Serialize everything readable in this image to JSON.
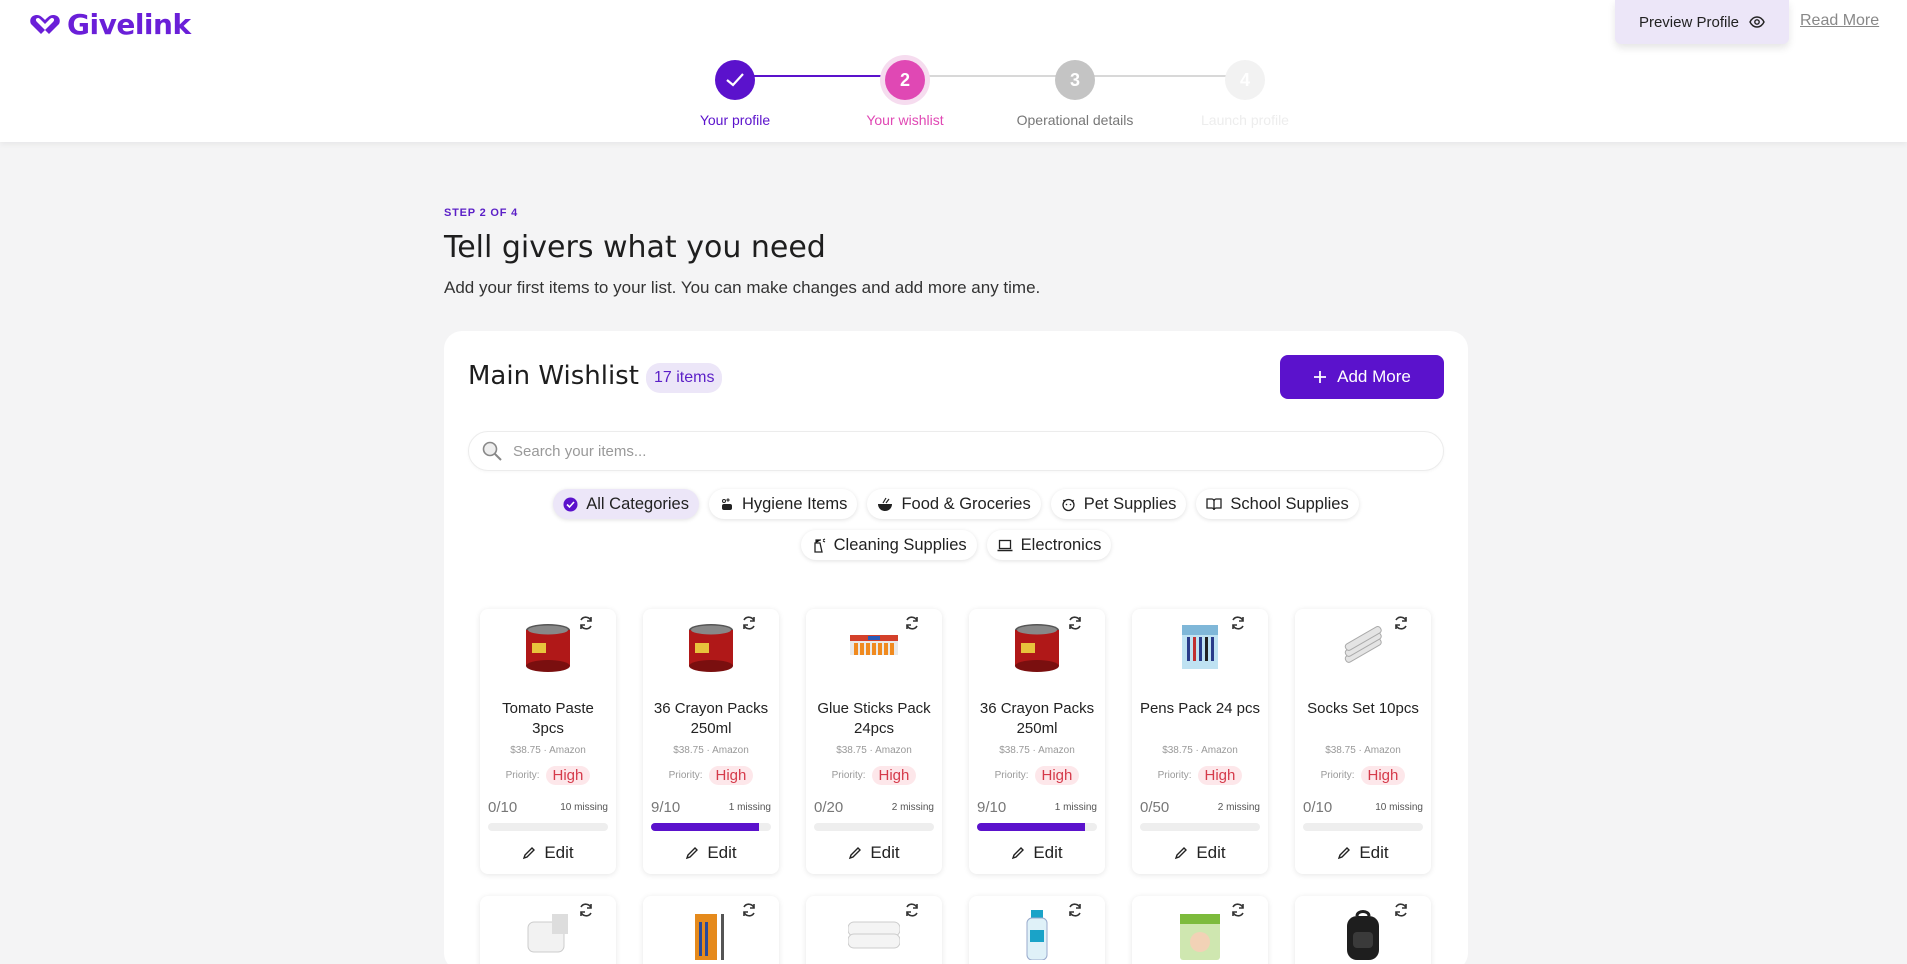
{
  "brand": {
    "name": "Givelink",
    "color": "#6a1fd8"
  },
  "header": {
    "preview_label": "Preview Profile",
    "read_more": "Read More"
  },
  "stepper": {
    "steps": [
      {
        "number": "1",
        "label": "Your profile",
        "state": "complete"
      },
      {
        "number": "2",
        "label": "Your wishlist",
        "state": "current"
      },
      {
        "number": "3",
        "label": "Operational details",
        "state": "upcoming"
      },
      {
        "number": "4",
        "label": "Launch profile",
        "state": "disabled"
      }
    ]
  },
  "content": {
    "kicker": "STEP 2 OF 4",
    "title": "Tell givers what you need",
    "subtitle": "Add your first items to your list. You can  make changes and add more any time."
  },
  "wishlist": {
    "title": "Main Wishlist",
    "count": "17 items",
    "add_label": "Add More",
    "search_placeholder": "Search your items..."
  },
  "categories": {
    "row1": [
      {
        "label": "All Categories",
        "icon": "check-circle-icon",
        "active": true
      },
      {
        "label": "Hygiene Items",
        "icon": "soap-icon",
        "active": false
      },
      {
        "label": "Food & Groceries",
        "icon": "bowl-icon",
        "active": false
      },
      {
        "label": "Pet Supplies",
        "icon": "pet-icon",
        "active": false
      },
      {
        "label": "School Supplies",
        "icon": "book-icon",
        "active": false
      }
    ],
    "row2": [
      {
        "label": "Cleaning Supplies",
        "icon": "spray-icon",
        "active": false
      },
      {
        "label": "Electronics",
        "icon": "laptop-icon",
        "active": false
      }
    ]
  },
  "items": [
    {
      "name": "Tomato Paste 3pcs",
      "meta": "$38.75 · Amazon",
      "priority_label": "Priority:",
      "priority": "High",
      "qty": "0/10",
      "missing": "10 missing",
      "progress": 0,
      "edit": "Edit",
      "image": "can-icon"
    },
    {
      "name": "36 Crayon Packs 250ml",
      "meta": "$38.75 · Amazon",
      "priority_label": "Priority:",
      "priority": "High",
      "qty": "9/10",
      "missing": "1 missing",
      "progress": 0.9,
      "edit": "Edit",
      "image": "can-icon"
    },
    {
      "name": "Glue Sticks Pack 24pcs",
      "meta": "$38.75 · Amazon",
      "priority_label": "Priority:",
      "priority": "High",
      "qty": "0/20",
      "missing": "2 missing",
      "progress": 0,
      "edit": "Edit",
      "image": "glue-icon"
    },
    {
      "name": "36 Crayon Packs 250ml",
      "meta": "$38.75 · Amazon",
      "priority_label": "Priority:",
      "priority": "High",
      "qty": "9/10",
      "missing": "1 missing",
      "progress": 0.9,
      "edit": "Edit",
      "image": "can-icon"
    },
    {
      "name": "Pens Pack 24 pcs",
      "meta": "$38.75 · Amazon",
      "priority_label": "Priority:",
      "priority": "High",
      "qty": "0/50",
      "missing": "2 missing",
      "progress": 0,
      "edit": "Edit",
      "image": "pens-box-icon"
    },
    {
      "name": "Socks Set 10pcs",
      "meta": "$38.75 · Amazon",
      "priority_label": "Priority:",
      "priority": "High",
      "qty": "0/10",
      "missing": "10 missing",
      "progress": 0,
      "edit": "Edit",
      "image": "socks-icon"
    }
  ],
  "items_row2": [
    {
      "image": "pillow-icon"
    },
    {
      "image": "pencils-icon"
    },
    {
      "image": "towel-icon"
    },
    {
      "image": "bottle-icon"
    },
    {
      "image": "diapers-icon"
    },
    {
      "image": "backpack-icon"
    }
  ],
  "colors": {
    "accent": "#5b12cc",
    "pink": "#e048b4",
    "priority": "#d53a4a"
  }
}
